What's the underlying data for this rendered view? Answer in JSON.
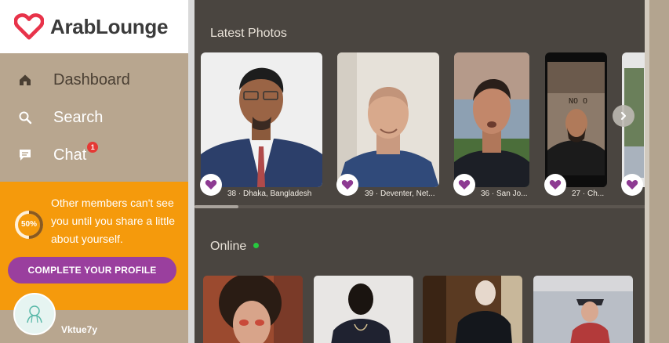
{
  "app": {
    "name": "ArabLounge"
  },
  "sidebar": {
    "items": [
      {
        "label": "Dashboard",
        "icon": "home-icon"
      },
      {
        "label": "Search",
        "icon": "search-icon"
      },
      {
        "label": "Chat",
        "icon": "chat-icon",
        "badge": "1"
      }
    ]
  },
  "profile_prompt": {
    "progress": "50%",
    "progress_value": 0.5,
    "message": "Other members can't see you until you share a little about yourself.",
    "button": "COMPLETE YOUR PROFILE"
  },
  "user": {
    "name": "Vktue7y",
    "avatar_icon": "user-avatar-icon"
  },
  "latest_photos": {
    "title": "Latest Photos",
    "items": [
      {
        "caption": "38 · Dhaka, Bangladesh"
      },
      {
        "caption": "39 · Deventer, Net..."
      },
      {
        "caption": "36 · San Jo..."
      },
      {
        "caption": "27 · Ch..."
      },
      {
        "caption": ""
      }
    ]
  },
  "online": {
    "title": "Online"
  },
  "colors": {
    "accent_orange": "#f59a0c",
    "brand_purple": "#9a3f9e",
    "brand_red": "#e8334a",
    "online_green": "#27c93f"
  }
}
